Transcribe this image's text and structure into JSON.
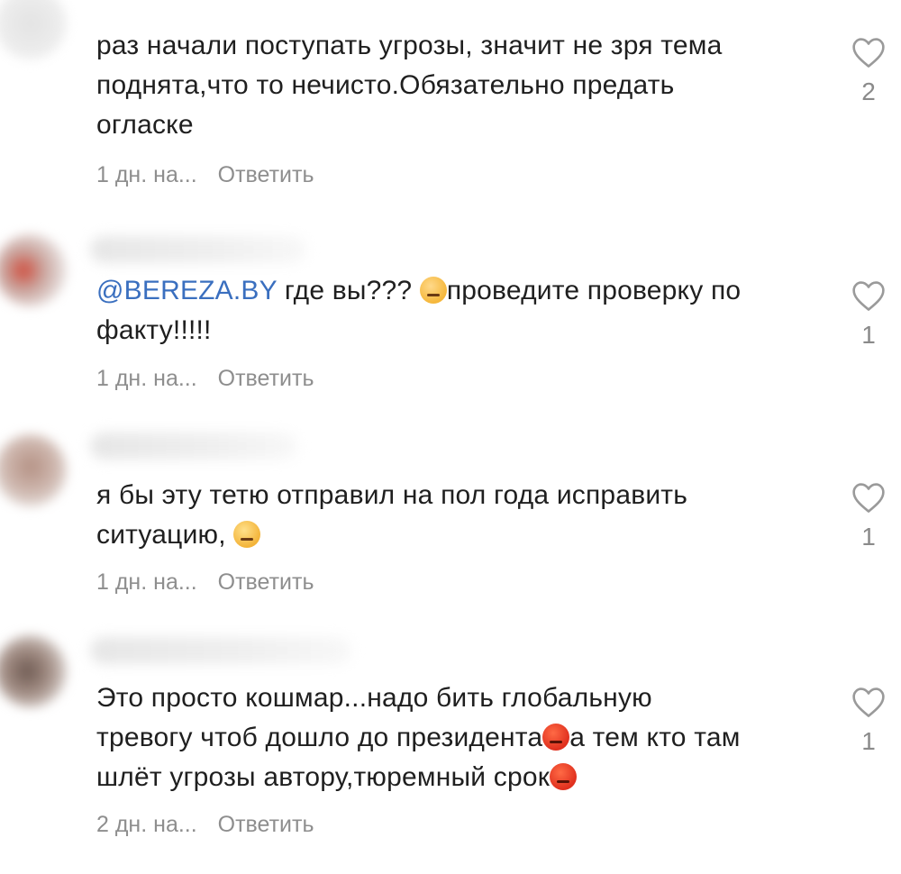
{
  "comments": [
    {
      "lines": [
        "раз начали поступать угрозы, значит не зря тема",
        "поднята,что то нечисто.Обязательно предать",
        "огласке"
      ],
      "time": "1 дн. на...",
      "reply": "Ответить",
      "likes": "2"
    },
    {
      "mention": "@BEREZA.BY",
      "line1_rest": " где вы??? ",
      "line1_after_emoji": "проведите проверку по",
      "line2": "факту!!!!!",
      "time": "1 дн. на...",
      "reply": "Ответить",
      "likes": "1"
    },
    {
      "line1": "я бы эту тетю отправил на пол года исправить",
      "line2": "ситуацию, ",
      "time": "1 дн. на...",
      "reply": "Ответить",
      "likes": "1"
    },
    {
      "line1": "Это просто кошмар...надо бить глобальную",
      "line2_a": "тревогу чтоб дошло до президента",
      "line2_b": "а тем кто там",
      "line3": "шлёт угрозы автору,тюремный срок",
      "time": "2 дн. на...",
      "reply": "Ответить",
      "likes": "1"
    }
  ],
  "icons": {
    "like": "heart-outline-icon",
    "emoji_thinking": "thinking-face-emoji",
    "emoji_laughing": "tears-of-joy-emoji",
    "emoji_angry": "angry-face-emoji"
  },
  "colors": {
    "text": "#1f1f1f",
    "meta": "#8e8e8e",
    "mention": "#3a6fbf",
    "heart": "#9a9a9a"
  }
}
